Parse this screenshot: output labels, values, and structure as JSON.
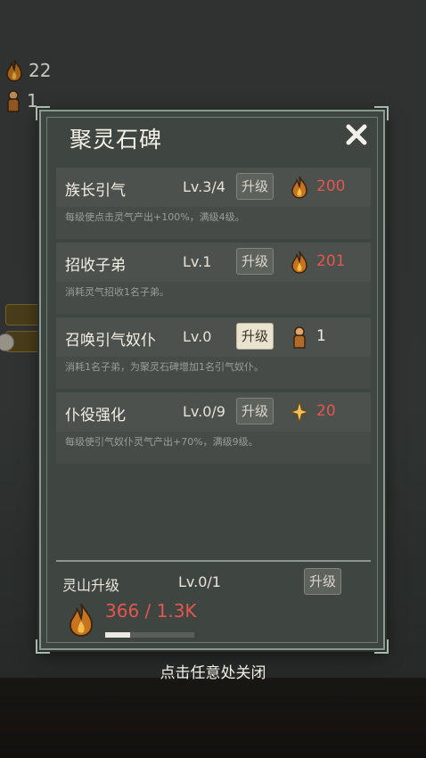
{
  "resources": {
    "lingqi": "22",
    "disciples": "1"
  },
  "dialog": {
    "title": "聚灵石碑",
    "upgrades": [
      {
        "name": "族长引气",
        "level": "Lv.3/4",
        "button": "升级",
        "cost": "200",
        "cost_icon": "fire-icon",
        "desc": "每级使点击灵气产出+100%，满级4级。"
      },
      {
        "name": "招收子弟",
        "level": "Lv.1",
        "button": "升级",
        "cost": "201",
        "cost_icon": "fire-icon",
        "desc": "消耗灵气招收1名子弟。"
      },
      {
        "name": "召唤引气奴仆",
        "level": "Lv.0",
        "button": "升级",
        "cost": "1",
        "cost_icon": "disciple-icon",
        "desc": "消耗1名子弟，为聚灵石碑增加1名引气奴仆。"
      },
      {
        "name": "仆役强化",
        "level": "Lv.0/9",
        "button": "升级",
        "cost": "20",
        "cost_icon": "star-icon",
        "desc": "每级使引气奴仆灵气产出+70%，满级9级。"
      }
    ],
    "mountain": {
      "name": "灵山升级",
      "level": "Lv.0/1",
      "button": "升级",
      "progress_text": "366 / 1.3K",
      "progress": 0.28
    }
  },
  "hint": "点击任意处关闭",
  "colors": {
    "cost_red": "#e2574e",
    "button_active": "#e9e2cf",
    "panel": "#3f4541"
  }
}
